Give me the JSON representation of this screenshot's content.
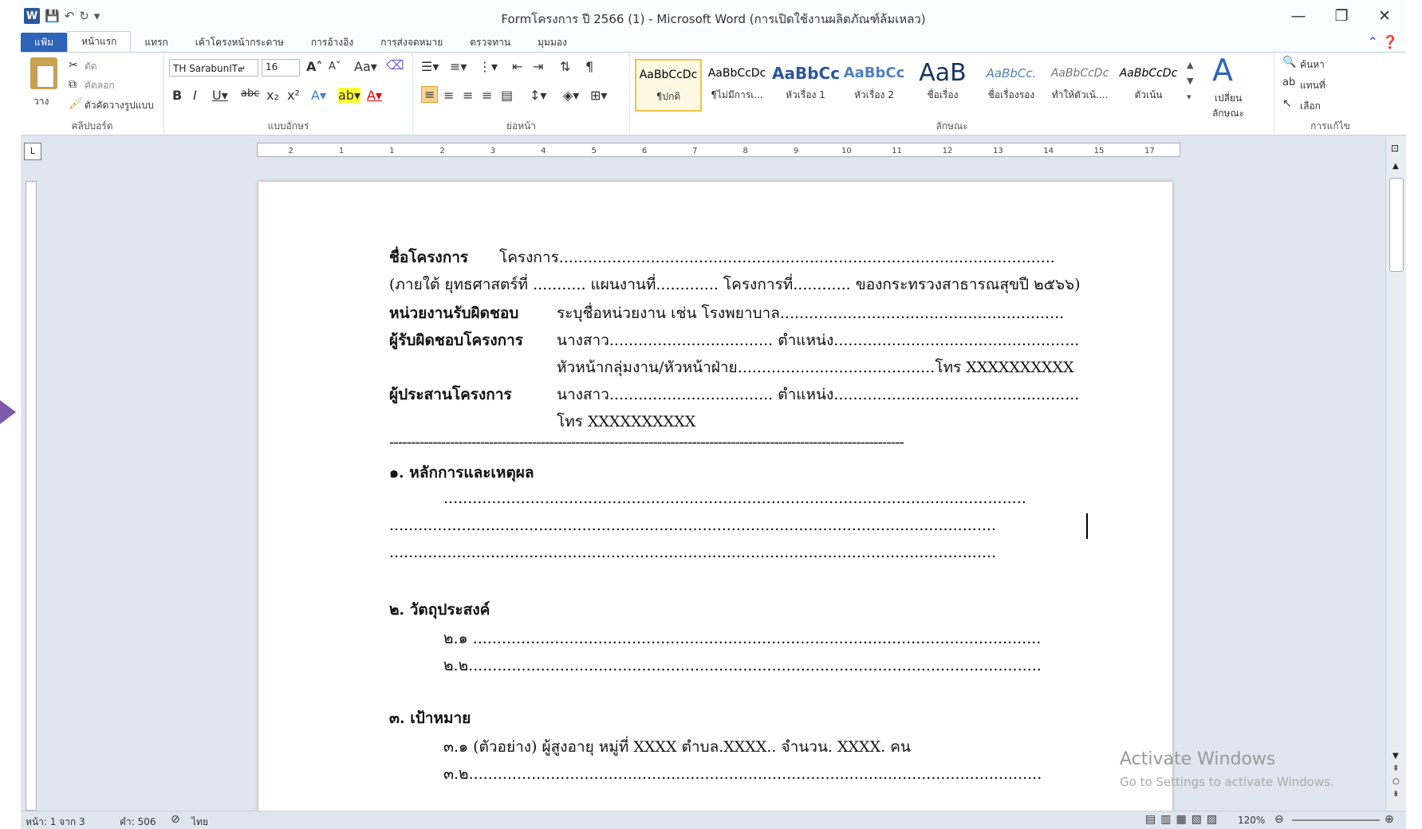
{
  "window": {
    "title": "Formโครงการ ปี 2566 (1) - Microsoft Word (การเปิดใช้งานผลิตภัณฑ์ล้มเหลว)",
    "controls": [
      "—",
      "❐",
      "✕"
    ]
  },
  "tabs": [
    "แฟ้ม",
    "หน้าแรก",
    "แทรก",
    "เค้าโครงหน้ากระดาษ",
    "การอ้างอิง",
    "การส่งจดหมาย",
    "ตรวจทาน",
    "มุมมอง"
  ],
  "ribbon": {
    "clipboard": {
      "label": "คลิปบอร์ด",
      "paste": "วาง",
      "cut": "ตัด",
      "copy": "คัดลอก",
      "format_painter": "ตัวคัดวางรูปแบบ"
    },
    "font": {
      "label": "แบบอักษร",
      "name": "TH SarabunIT๙",
      "size": "16"
    },
    "paragraph": {
      "label": "ย่อหน้า"
    },
    "styles": {
      "label": "ลักษณะ",
      "items": [
        {
          "preview": "AaBbCcDc",
          "name": "¶ปกติ"
        },
        {
          "preview": "AaBbCcDc",
          "name": "¶ไม่มีการเ..."
        },
        {
          "preview": "AaBbCc",
          "name": "หัวเรื่อง 1"
        },
        {
          "preview": "AaBbCc",
          "name": "หัวเรื่อง 2"
        },
        {
          "preview": "AaB",
          "name": "ชื่อเรื่อง"
        },
        {
          "preview": "AaBbCc.",
          "name": "ชื่อเรื่องรอง"
        },
        {
          "preview": "AaBbCcDc",
          "name": "ทำให้ตัวเน้...."
        },
        {
          "preview": "AaBbCcDc",
          "name": "ตัวเน้น"
        }
      ],
      "change": "เปลี่ยน ลักษณะ"
    },
    "editing": {
      "label": "การแก้ไข",
      "find": "ค้นหา",
      "replace": "แทนที่",
      "select": "เลือก"
    }
  },
  "ruler_numbers": [
    "2",
    "1",
    "1",
    "2",
    "3",
    "4",
    "5",
    "6",
    "7",
    "8",
    "9",
    "10",
    "11",
    "12",
    "13",
    "14",
    "15",
    "17"
  ],
  "doc": {
    "line1_label": "ชื่อโครงการ",
    "line1_value": "โครงการ.......................................................................................................",
    "line2": "(ภายใต้ ยุทธศาสตร์ที่ ........... แผนงานที่............. โครงการที่............ ของกระทรวงสาธารณสุขปี ๒๕๖๖)",
    "line3_label": "หน่วยงานรับผิดชอบ",
    "line3_value": "ระบุชื่อหน่วยงาน เช่น โรงพยาบาล...........................................................",
    "line4_label": "ผู้รับผิดชอบโครงการ",
    "line4_value": "นางสาว..................................  ตำแหน่ง...................................................",
    "line5_value": "หัวหน้ากลุ่มงาน/หัวหน้าฝ่าย.........................................โทร  XXXXXXXXXX",
    "line6_label": "ผู้ประสานโครงการ",
    "line6_value": "นางสาว..................................  ตำแหน่ง...................................................",
    "line7_value": "โทร XXXXXXXXXX",
    "separator": "-----------------------------------------------------------------------------------------------------------------------",
    "s1_title": "๑. หลักการและเหตุผล",
    "s1_l1": ".........................................................................................................................",
    "s1_l2": "..............................................................................................................................",
    "s1_l3": "..............................................................................................................................",
    "s2_title": "๒. วัตถุประสงค์",
    "s2_l1": "๒.๑ ......................................................................................................................",
    "s2_l2": "๒.๒.......................................................................................................................",
    "s3_title": "๓. เป้าหมาย",
    "s3_l1": "๓.๑ (ตัวอย่าง) ผู้สูงอายุ หมู่ที่ XXXX ตำบล.XXXX.. จำนวน. XXXX. คน",
    "s3_l2": "๓.๒......................................................................................................................."
  },
  "watermark": {
    "title": "Activate Windows",
    "sub": "Go to Settings to activate Windows."
  },
  "status": {
    "page": "หน้า: 1 จาก 3",
    "words": "คำ: 506",
    "lang": "ไทย",
    "zoom": "120%"
  }
}
